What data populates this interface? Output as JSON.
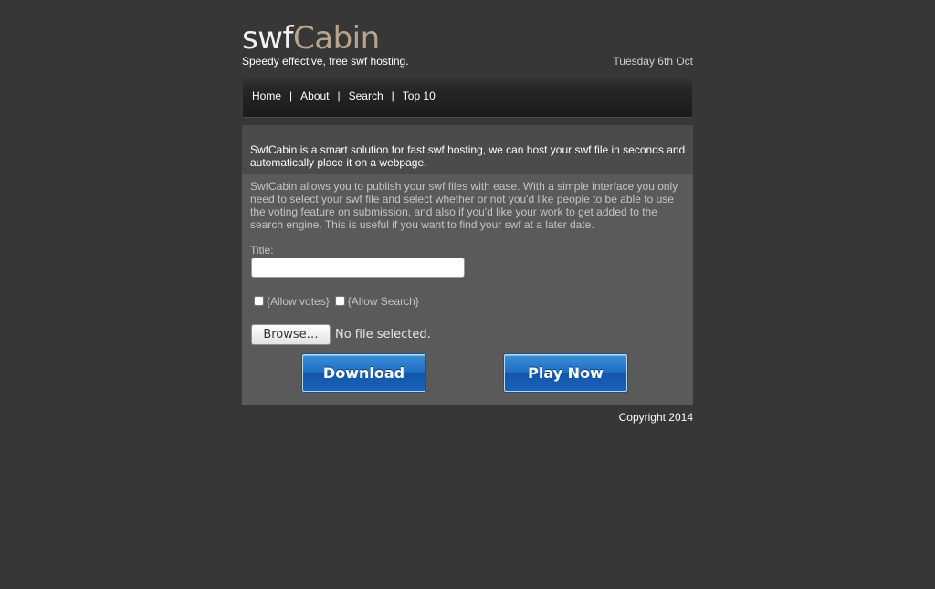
{
  "header": {
    "logo_part1": "swf",
    "logo_part2": "Cabin",
    "tagline": "Speedy effective, free swf hosting.",
    "date": "Tuesday 6th Oct"
  },
  "nav": {
    "items": [
      {
        "label": "Home"
      },
      {
        "label": "About"
      },
      {
        "label": "Search"
      },
      {
        "label": "Top 10"
      }
    ],
    "separator": "|"
  },
  "main": {
    "intro": "SwfCabin is a smart solution for fast swf hosting, we can host your swf file in seconds and automatically place it on a webpage.",
    "description": "SwfCabin allows you to publish your swf files with ease. With a simple interface you only need to select your swf file and select whether or not you'd like people to be able to use the voting feature on submission, and also if you'd like your work to get added to the search engine. This is useful if you want to find your swf at a later date.",
    "form": {
      "title_label": "Title:",
      "title_value": "",
      "allow_votes_label": "{Allow votes}",
      "allow_votes_checked": false,
      "allow_search_label": "{Allow Search}",
      "allow_search_checked": false,
      "browse_label": "Browse…",
      "file_status": "No file selected.",
      "download_label": "Download",
      "play_label": "Play Now"
    }
  },
  "footer": {
    "copyright": "Copyright 2014"
  },
  "colors": {
    "background": "#373737",
    "content_panel": "#5a5a5a",
    "logo_accent": "#b7a48c",
    "button_blue": "#1d6bc4"
  }
}
